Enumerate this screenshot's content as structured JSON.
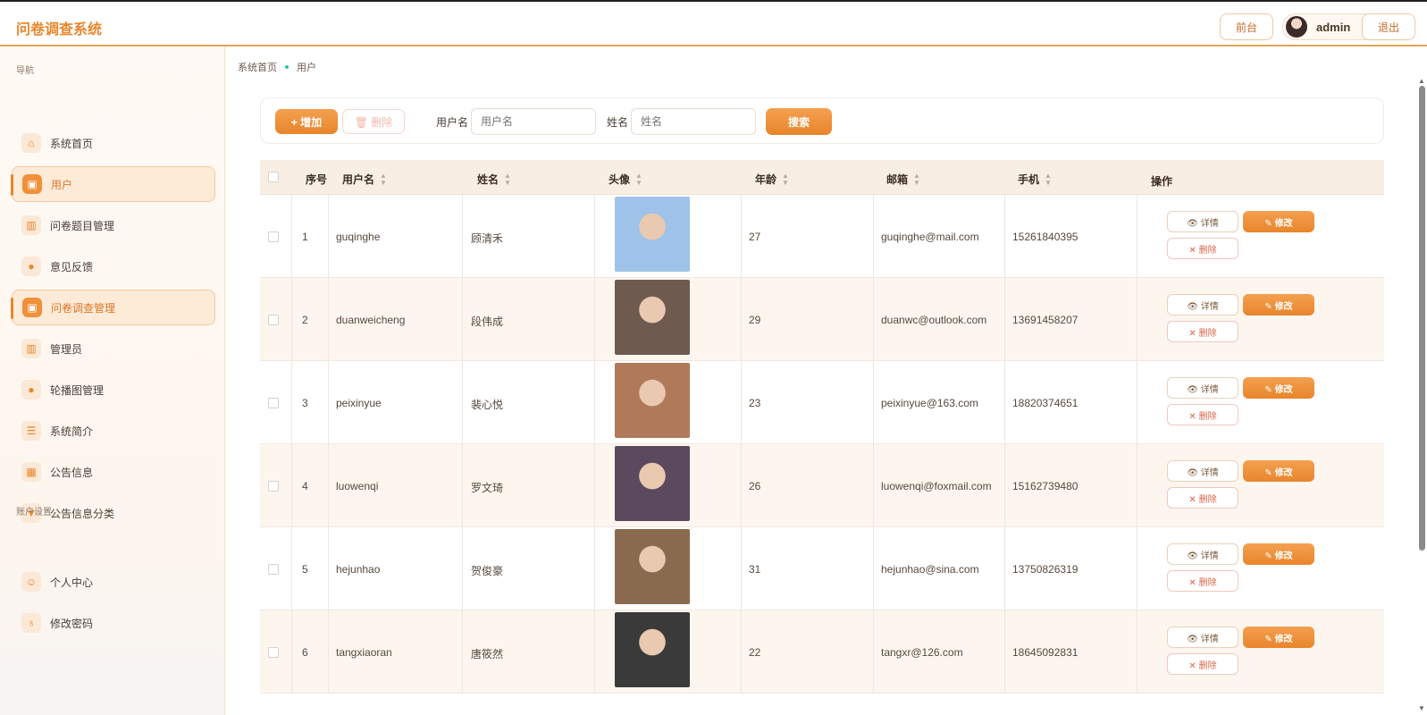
{
  "header": {
    "app_title": "问卷调查系统",
    "front_label": "前台",
    "user_name": "admin",
    "logout_label": "退出"
  },
  "sidebar": {
    "nav_section": "导航",
    "account_section": "账户设置",
    "items": [
      {
        "label": "系统首页",
        "icon": "home-icon",
        "glyph": "⌂"
      },
      {
        "label": "用户",
        "icon": "briefcase-icon",
        "glyph": "▣"
      },
      {
        "label": "问卷题目管理",
        "icon": "bar-chart-icon",
        "glyph": "▥"
      },
      {
        "label": "意见反馈",
        "icon": "pin-icon",
        "glyph": "●"
      },
      {
        "label": "问卷调查管理",
        "icon": "briefcase-icon",
        "glyph": "▣"
      },
      {
        "label": "管理员",
        "icon": "bar-chart-icon",
        "glyph": "▥"
      },
      {
        "label": "轮播图管理",
        "icon": "pin-icon",
        "glyph": "●"
      },
      {
        "label": "系统简介",
        "icon": "sliders-icon",
        "glyph": "☰"
      },
      {
        "label": "公告信息",
        "icon": "grid-icon",
        "glyph": "▦"
      },
      {
        "label": "公告信息分类",
        "icon": "trophy-icon",
        "glyph": "▼"
      }
    ],
    "account_items": [
      {
        "label": "个人中心",
        "icon": "person-icon",
        "glyph": "☺"
      },
      {
        "label": "修改密码",
        "icon": "lock-icon",
        "glyph": "♁"
      }
    ]
  },
  "breadcrumb": {
    "home": "系统首页",
    "current": "用户"
  },
  "toolbar": {
    "add_label": "+ 增加",
    "delete_label": "🗑 删除",
    "username_label": "用户名",
    "username_placeholder": "用户名",
    "name_label": "姓名",
    "name_placeholder": "姓名",
    "search_label": "搜索"
  },
  "table": {
    "columns": [
      "序号",
      "用户名",
      "姓名",
      "头像",
      "年龄",
      "邮箱",
      "手机",
      "操作"
    ],
    "action_labels": {
      "detail": "👁 详情",
      "edit": "✎ 修改",
      "delete": "✕ 删除"
    },
    "rows": [
      {
        "no": "1",
        "username": "guqinghe",
        "name": "顾清禾",
        "age": "27",
        "email": "guqinghe@mail.com",
        "phone": "15261840395",
        "photo_color": "#9fc3e8"
      },
      {
        "no": "2",
        "username": "duanweicheng",
        "name": "段伟成",
        "age": "29",
        "email": "duanwc@outlook.com",
        "phone": "13691458207",
        "photo_color": "#6e5a4e"
      },
      {
        "no": "3",
        "username": "peixinyue",
        "name": "裴心悦",
        "age": "23",
        "email": "peixinyue@163.com",
        "phone": "18820374651",
        "photo_color": "#b07a5a"
      },
      {
        "no": "4",
        "username": "luowenqi",
        "name": "罗文琦",
        "age": "26",
        "email": "luowenqi@foxmail.com",
        "phone": "15162739480",
        "photo_color": "#5b4a5e"
      },
      {
        "no": "5",
        "username": "hejunhao",
        "name": "贺俊豪",
        "age": "31",
        "email": "hejunhao@sina.com",
        "phone": "13750826319",
        "photo_color": "#8a6a4e"
      },
      {
        "no": "6",
        "username": "tangxiaoran",
        "name": "唐筱然",
        "age": "22",
        "email": "tangxr@126.com",
        "phone": "18645092831",
        "photo_color": "#3a3a3a"
      }
    ]
  },
  "colors": {
    "accent": "#e8872c",
    "accent_light": "#fdebd8"
  }
}
